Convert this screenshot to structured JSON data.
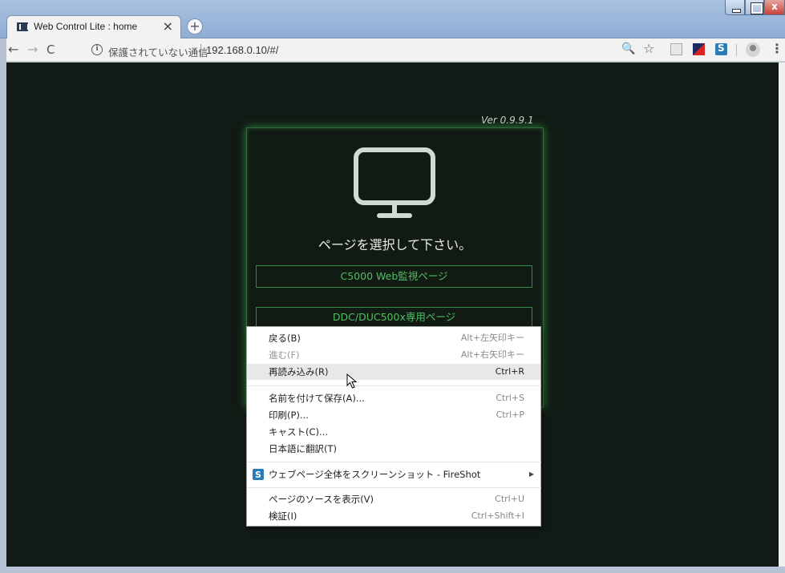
{
  "browser": {
    "tab_title": "Web Control Lite : home",
    "tab_close": "×",
    "new_tab": "+",
    "security_text": "保護されていない通信",
    "url": "192.168.0.10/#/",
    "info_glyph": "i",
    "back": "←",
    "forward": "→",
    "reload": "C",
    "zoom": "🔍",
    "star": "☆",
    "menu": "⋮",
    "close_glyph": "x"
  },
  "page": {
    "version": "Ver 0.9.9.1",
    "prompt": "ページを選択して下さい。",
    "buttons": [
      {
        "label": "C5000 Web監視ページ"
      },
      {
        "label": "DDC/DUC500x専用ページ"
      }
    ],
    "colors": {
      "background": "#111a14",
      "accent": "#4fbe62",
      "border": "#2f8a43"
    }
  },
  "context_menu": {
    "items": [
      {
        "label": "戻る(B)",
        "shortcut": "Alt+左矢印キー",
        "enabled": true
      },
      {
        "label": "進む(F)",
        "shortcut": "Alt+右矢印キー",
        "enabled": false
      },
      {
        "label": "再読み込み(R)",
        "shortcut": "Ctrl+R",
        "enabled": true,
        "highlighted": true
      },
      {
        "label": "名前を付けて保存(A)...",
        "shortcut": "Ctrl+S",
        "enabled": true
      },
      {
        "label": "印刷(P)...",
        "shortcut": "Ctrl+P",
        "enabled": true
      },
      {
        "label": "キャスト(C)...",
        "shortcut": "",
        "enabled": true
      },
      {
        "label": "日本語に翻訳(T)",
        "shortcut": "",
        "enabled": true
      },
      {
        "label": "ウェブページ全体をスクリーンショット - FireShot",
        "shortcut": "",
        "enabled": true,
        "submenu": true,
        "icon": "fireshot-icon"
      },
      {
        "label": "ページのソースを表示(V)",
        "shortcut": "Ctrl+U",
        "enabled": true
      },
      {
        "label": "検証(I)",
        "shortcut": "Ctrl+Shift+I",
        "enabled": true
      }
    ],
    "submenu_glyph": "▶"
  }
}
